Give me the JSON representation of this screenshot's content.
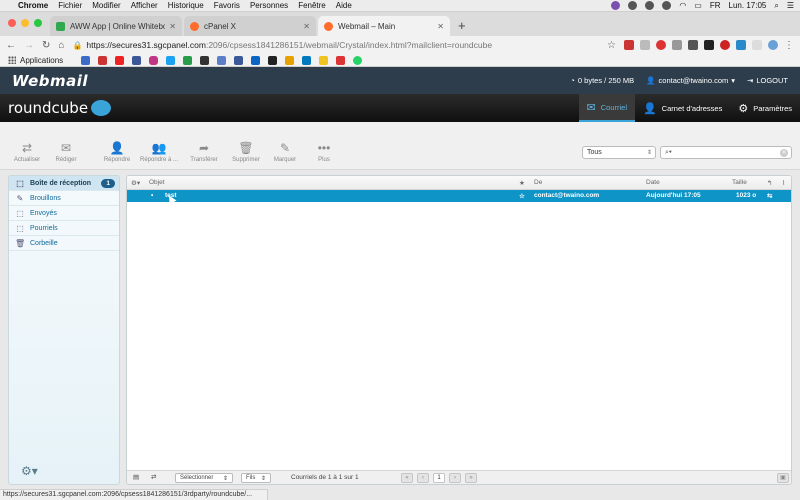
{
  "menubar": {
    "app": "Chrome",
    "items": [
      "Fichier",
      "Modifier",
      "Afficher",
      "Historique",
      "Favoris",
      "Personnes",
      "Fenêtre",
      "Aide"
    ],
    "flag": "FR",
    "clock": "Lun. 17:05"
  },
  "browser": {
    "tabs": [
      {
        "label": "AWW App | Online Whiteboard"
      },
      {
        "label": "cPanel X"
      },
      {
        "label": "Webmail – Main"
      }
    ],
    "url_host": "https://secures31.sgcpanel.com",
    "url_path": ":2096/cpsess1841286151/webmail/Crystal/index.html?mailclient=roundcube",
    "bookmarks_label": "Applications"
  },
  "webmail": {
    "logo": "Webmail",
    "quota": "0 bytes / 250 MB",
    "user": "contact@twaino.com",
    "logout": "LOGOUT"
  },
  "roundcube": {
    "logo": "roundcube",
    "nav": [
      {
        "label": "Courriel",
        "active": true
      },
      {
        "label": "Carnet d'adresses",
        "active": false
      },
      {
        "label": "Paramètres",
        "active": false
      }
    ]
  },
  "toolbar": {
    "buttons": [
      "Actualiser",
      "Rédiger",
      "Répondre",
      "Répondre à ...",
      "Transférer",
      "Supprimer",
      "Marquer",
      "Plus"
    ],
    "filter": "Tous",
    "search_prefix": "Q"
  },
  "folders": [
    {
      "label": "Boîte de réception",
      "count": "1",
      "selected": true
    },
    {
      "label": "Brouillons"
    },
    {
      "label": "Envoyés"
    },
    {
      "label": "Pourriels"
    },
    {
      "label": "Corbeille"
    }
  ],
  "list": {
    "headers": {
      "subject": "Objet",
      "from": "De",
      "date": "Date",
      "size": "Taille"
    },
    "rows": [
      {
        "subject": "test",
        "from": "contact@twaino.com",
        "date": "Aujourd'hui 17:05",
        "size": "1023 o"
      }
    ],
    "footer": {
      "select": "Sélectionner",
      "threads": "Fils",
      "count": "Courriels de 1 à 1 sur 1",
      "page": "1"
    }
  },
  "statusbar": "https://secures31.sgcpanel.com:2096/cpsess1841286151/3rdparty/roundcube/..."
}
